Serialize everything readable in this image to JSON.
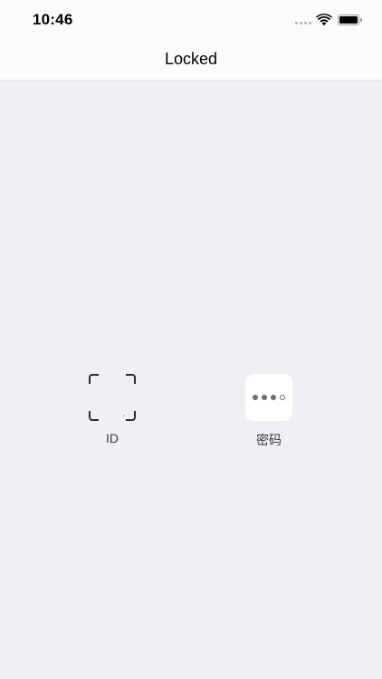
{
  "status_bar": {
    "time": "10:46",
    "signal_icon": "signal-icon",
    "wifi_icon": "wifi-icon",
    "battery_icon": "battery-icon",
    "battery_level": 1.0
  },
  "nav": {
    "title": "Locked"
  },
  "unlock_options": [
    {
      "label": "ID",
      "icon": "face-id-frame-icon"
    },
    {
      "label": "密码",
      "icon": "passcode-dots-icon"
    }
  ],
  "colors": {
    "background": "#efeff4",
    "bar_background": "#fbfbfb",
    "icon_dark": "#2b2b2b",
    "label_text": "#3a3a3c"
  }
}
